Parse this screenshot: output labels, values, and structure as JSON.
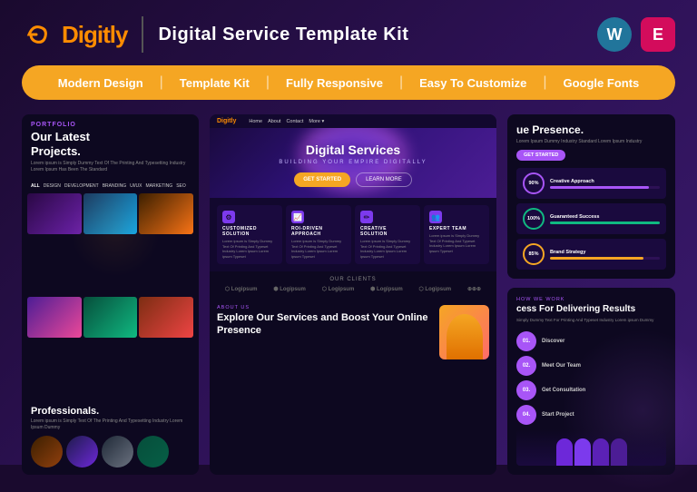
{
  "header": {
    "logo_text_d": "D",
    "logo_text_rest": "igitly",
    "title": "Digital Service Template Kit",
    "wp_icon": "W",
    "elementor_icon": "E"
  },
  "features": {
    "items": [
      {
        "label": "Modern Design"
      },
      {
        "label": "Template Kit"
      },
      {
        "label": "Fully Responsive"
      },
      {
        "label": "Easy To Customize"
      },
      {
        "label": "Google Fonts"
      }
    ]
  },
  "preview_left": {
    "label": "PORTFOLIO",
    "title": "Our Latest\nProjects.",
    "desc": "Lorem ipsum is Simply Dummy Text Of The Printing And Typesetting Industry Lorem Ipsum Has Been The Standard",
    "filters": [
      "ALL",
      "DESIGN",
      "DEVELOPMENT",
      "BRANDING",
      "UI/UX",
      "MARKETING",
      "SEO"
    ],
    "professionals_title": "Professionals.",
    "professionals_desc": "Lorem ipsum is Simply Text Of The Printing And Typesetting Industry Lorem Ipsum Dummy"
  },
  "preview_center": {
    "nav_logo": "Digitly",
    "nav_links": [
      "Home",
      "About",
      "Contact",
      "More"
    ],
    "hero_title": "Digital Services",
    "hero_subtitle": "BUILDING YOUR EMPIRE DIGITALLY",
    "btn_started": "GET STARTED",
    "btn_learn": "LEARN MORE",
    "services": [
      {
        "icon": "⚙",
        "title": "CUSTOMIZED SOLUTION",
        "desc": "Lorem ipsum is Simply Dummy Text Of Printing And Typeset Industry Lorem Ipsum Lorem ipsum Typeset"
      },
      {
        "icon": "📈",
        "title": "ROI-DRIVEN APPROACH",
        "desc": "Lorem ipsum is Simply Dummy Text Of Printing And Typeset Industry Lorem Ipsum Lorem ipsum Typeset"
      },
      {
        "icon": "✏",
        "title": "CREATIVE SOLUTION",
        "desc": "Lorem ipsum is Simply Dummy Text Of Printing And Typeset Industry Lorem Ipsum Lorem ipsum Typeset"
      },
      {
        "icon": "👥",
        "title": "EXPERT TEAM",
        "desc": "Lorem ipsum is Simply Dummy Text Of Printing And Typeset Industry Lorem Ipsum Lorem ipsum Typeset"
      }
    ],
    "clients_label": "OUR CLIENTS",
    "clients": [
      "Logipsum",
      "Logipsum",
      "Logipsum",
      "Logipsum",
      "Logipsum",
      "⊕⊕⊕"
    ],
    "about_label": "ABOUT US",
    "about_title": "Explore Our Services and Boost Your Online Presence"
  },
  "preview_right": {
    "presence_title": "ue Presence.",
    "presence_desc": "Lorem Ipsum Dummy Industry Standard Lorem Ipsum Industry",
    "cta_label": "GET STARTED",
    "stats": [
      {
        "value": "90%",
        "label": "Creative Approach",
        "fill": 90,
        "type": "purple"
      },
      {
        "value": "100%",
        "label": "Guaranteed Success",
        "fill": 100,
        "type": "green"
      },
      {
        "value": "85%",
        "label": "Brand Strategy",
        "fill": 85,
        "type": "orange"
      }
    ],
    "delivering_label": "HOW WE WORK",
    "delivering_title": "cess For Delivering Results",
    "delivering_desc": "Simply Dummy Text For Printing And Typeset Industry Lorem ipsum Dummy",
    "steps": [
      {
        "num": "01.",
        "label": "Discover"
      },
      {
        "num": "02.",
        "label": "Meet Our Team"
      },
      {
        "num": "03.",
        "label": "Get Consultation"
      },
      {
        "num": "04.",
        "label": "Start Project"
      }
    ]
  }
}
